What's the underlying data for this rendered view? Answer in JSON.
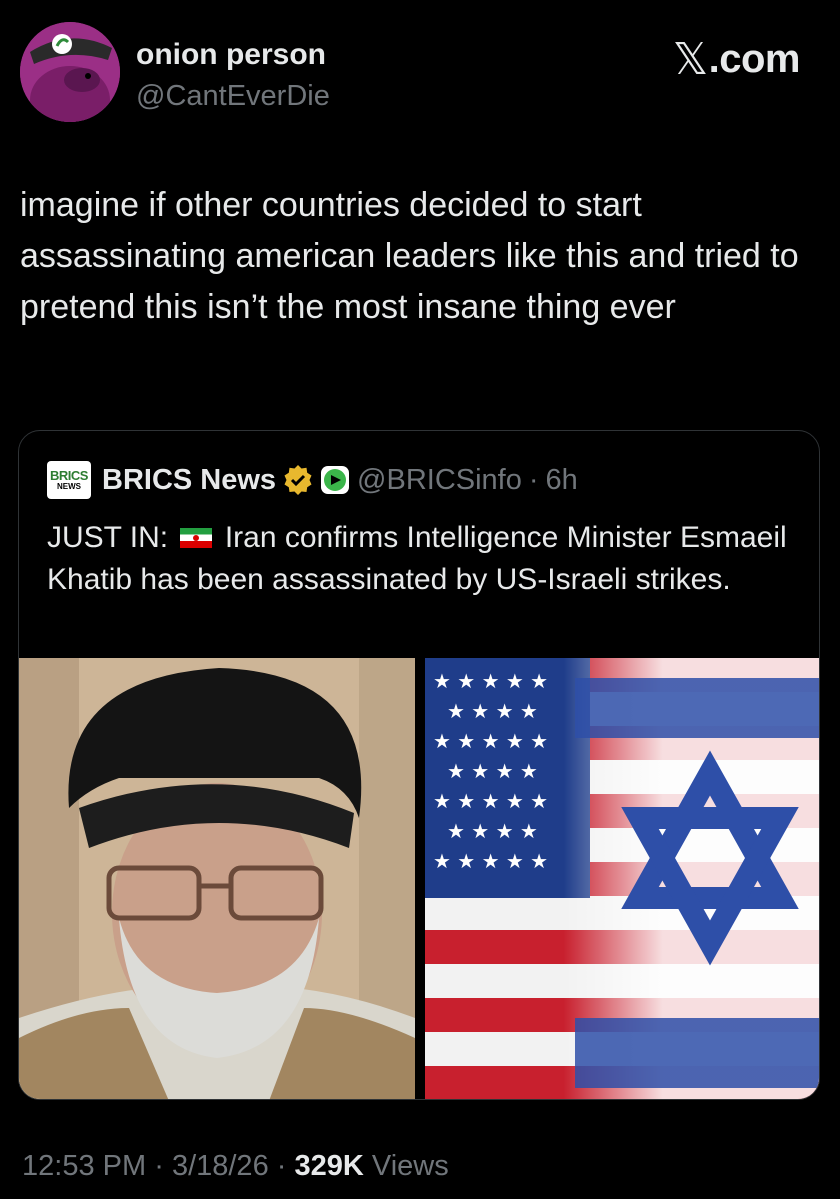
{
  "author": {
    "display_name": "onion person",
    "handle": "@CantEverDie",
    "avatar_icon": "onion-person-avatar"
  },
  "site_logo": {
    "glyph": "𝕏",
    "label": ".com"
  },
  "tweet": {
    "text": "imagine if other countries decided to start assassinating american leaders like this and tried to pretend this isn’t the most insane thing ever"
  },
  "quoted": {
    "logo_line1": "BRICS",
    "logo_line2": "NEWS",
    "name": "BRICS News",
    "handle": "@BRICSinfo",
    "separator": "·",
    "time": "6h",
    "text_prefix": "JUST IN:",
    "text_body": "Iran confirms Intelligence Minister Esmaeil Khatib has been assassinated by US-Israeli strikes.",
    "flag_icon": "iran-flag-icon"
  },
  "meta": {
    "time": "12:53 PM",
    "sep1": "·",
    "date": "3/18/26",
    "sep2": "·",
    "views_count": "329K",
    "views_label": "Views"
  },
  "colors": {
    "background": "#000000",
    "text": "#e7e9ea",
    "secondary": "#71767b",
    "border": "#2f3336",
    "verified_gold": "#e8b82e"
  }
}
